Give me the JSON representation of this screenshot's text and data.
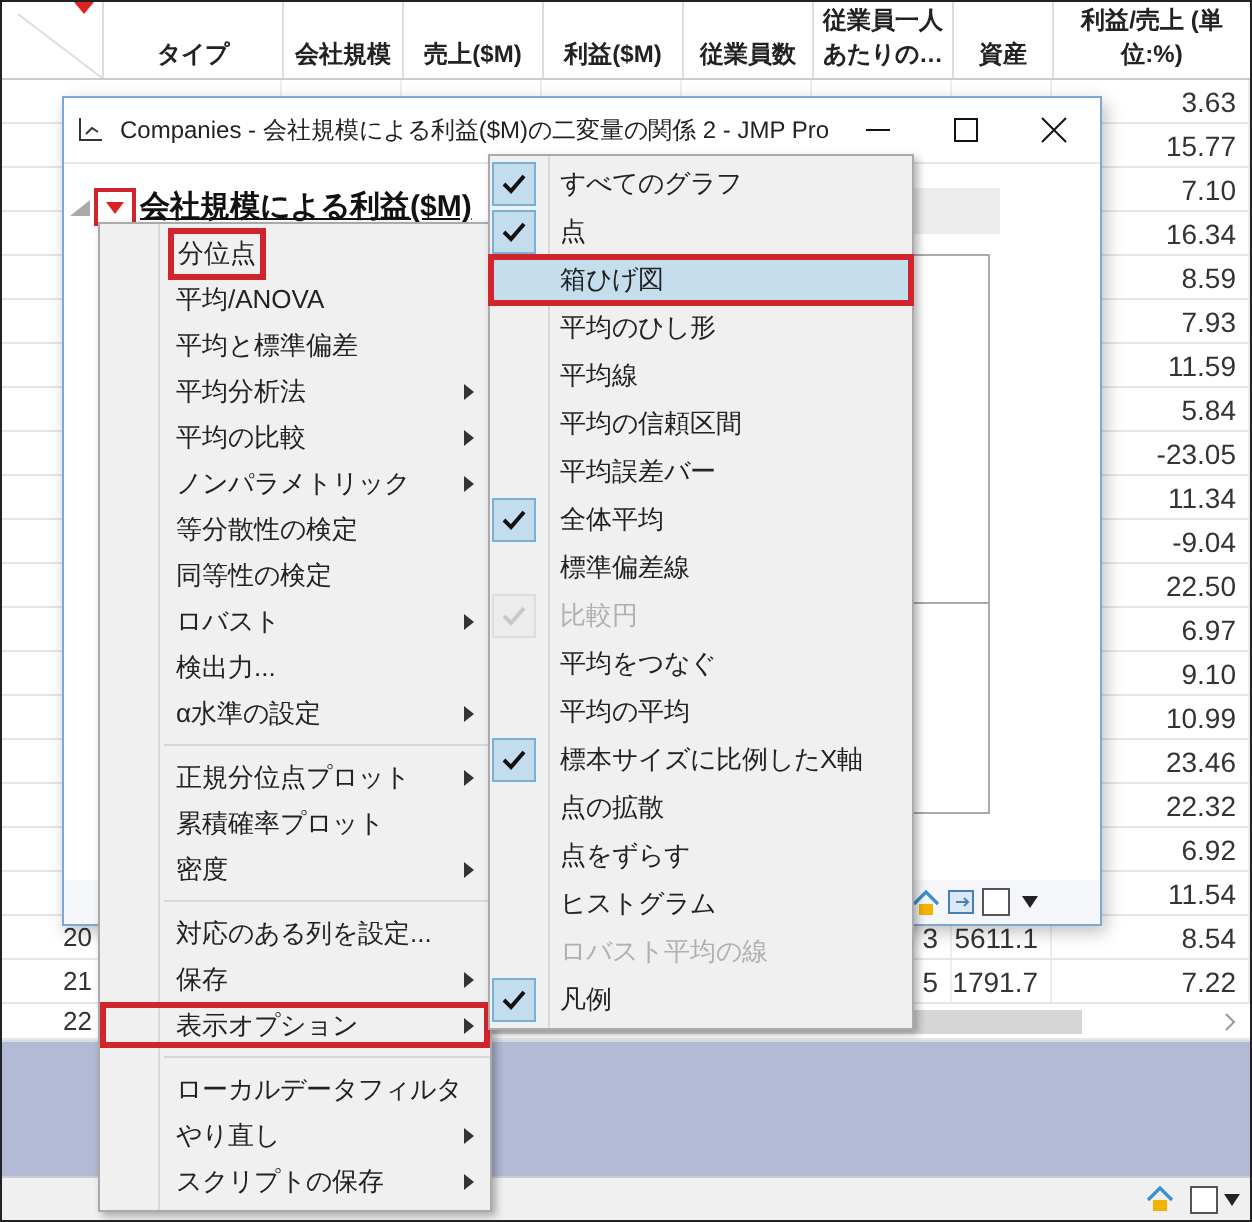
{
  "table": {
    "columns": [
      "タイプ",
      "会社規模",
      "売上($M)",
      "利益($M)",
      "従業員数",
      "従業員一人あたりの…",
      "資産",
      "利益/売上 (単位:%)"
    ],
    "rows": [
      {
        "cells": [
          null,
          null,
          null,
          null,
          null,
          null,
          null,
          "3.63"
        ]
      },
      {
        "cells": [
          null,
          null,
          null,
          null,
          null,
          null,
          null,
          "15.77"
        ]
      },
      {
        "cells": [
          null,
          null,
          null,
          null,
          null,
          null,
          null,
          "7.10"
        ]
      },
      {
        "cells": [
          null,
          null,
          null,
          null,
          null,
          null,
          null,
          "16.34"
        ]
      },
      {
        "cells": [
          null,
          null,
          null,
          null,
          null,
          null,
          null,
          "8.59"
        ]
      },
      {
        "cells": [
          null,
          null,
          null,
          null,
          null,
          null,
          null,
          "7.93"
        ]
      },
      {
        "cells": [
          null,
          null,
          null,
          null,
          null,
          null,
          null,
          "11.59"
        ]
      },
      {
        "cells": [
          null,
          null,
          null,
          null,
          null,
          null,
          null,
          "5.84"
        ]
      },
      {
        "cells": [
          null,
          null,
          null,
          null,
          null,
          null,
          null,
          "-23.05"
        ]
      },
      {
        "cells": [
          null,
          null,
          null,
          null,
          null,
          null,
          null,
          "11.34"
        ]
      },
      {
        "cells": [
          null,
          null,
          null,
          null,
          null,
          null,
          null,
          "-9.04"
        ]
      },
      {
        "cells": [
          null,
          null,
          null,
          null,
          null,
          null,
          null,
          "22.50"
        ]
      },
      {
        "cells": [
          null,
          null,
          null,
          null,
          null,
          null,
          null,
          "6.97"
        ]
      },
      {
        "cells": [
          null,
          null,
          null,
          null,
          null,
          null,
          null,
          "9.10"
        ]
      },
      {
        "cells": [
          null,
          null,
          null,
          null,
          null,
          null,
          null,
          "10.99"
        ]
      },
      {
        "cells": [
          null,
          null,
          null,
          null,
          null,
          null,
          null,
          "23.46"
        ]
      },
      {
        "cells": [
          null,
          null,
          null,
          null,
          null,
          null,
          null,
          "22.32"
        ]
      },
      {
        "cells": [
          null,
          null,
          null,
          null,
          null,
          null,
          null,
          "6.92"
        ]
      },
      {
        "cells": [
          null,
          null,
          null,
          null,
          null,
          null,
          null,
          "11.54"
        ]
      },
      {
        "number": "20",
        "cells": [
          null,
          null,
          null,
          null,
          null,
          "3",
          "5611.1",
          "8.54"
        ]
      },
      {
        "number": "21",
        "cells": [
          null,
          null,
          null,
          null,
          null,
          "5",
          "1791.7",
          "7.22"
        ]
      }
    ],
    "partial_row_number": "22"
  },
  "window": {
    "title": "Companies - 会社規模による利益($M)の二変量の関係 2 - JMP Pro",
    "heading": "会社規模による利益($M)"
  },
  "menu": {
    "groups": [
      [
        {
          "label": "分位点",
          "submenu": false,
          "annotated": true
        },
        {
          "label": "平均/ANOVA",
          "submenu": false,
          "annotated": false
        },
        {
          "label": "平均と標準偏差",
          "submenu": false,
          "annotated": false
        },
        {
          "label": "平均分析法",
          "submenu": true,
          "annotated": false
        },
        {
          "label": "平均の比較",
          "submenu": true,
          "annotated": false
        },
        {
          "label": "ノンパラメトリック",
          "submenu": true,
          "annotated": false
        },
        {
          "label": "等分散性の検定",
          "submenu": false,
          "annotated": false
        },
        {
          "label": "同等性の検定",
          "submenu": false,
          "annotated": false
        },
        {
          "label": "ロバスト",
          "submenu": true,
          "annotated": false
        },
        {
          "label": "検出力...",
          "submenu": false,
          "annotated": false
        },
        {
          "label": "α水準の設定",
          "submenu": true,
          "annotated": false
        }
      ],
      [
        {
          "label": "正規分位点プロット",
          "submenu": true,
          "annotated": false
        },
        {
          "label": "累積確率プロット",
          "submenu": false,
          "annotated": false
        },
        {
          "label": "密度",
          "submenu": true,
          "annotated": false
        }
      ],
      [
        {
          "label": "対応のある列を設定...",
          "submenu": false,
          "annotated": false
        },
        {
          "label": "保存",
          "submenu": true,
          "annotated": false
        },
        {
          "label": "表示オプション",
          "submenu": true,
          "annotated": true
        }
      ],
      [
        {
          "label": "ローカルデータフィルタ",
          "submenu": false,
          "annotated": false
        },
        {
          "label": "やり直し",
          "submenu": true,
          "annotated": false
        },
        {
          "label": "スクリプトの保存",
          "submenu": true,
          "annotated": false
        }
      ]
    ]
  },
  "submenu": {
    "items": [
      {
        "label": "すべてのグラフ",
        "checked": true,
        "disabled": false,
        "highlighted": false,
        "annotated": false
      },
      {
        "label": "点",
        "checked": true,
        "disabled": false,
        "highlighted": false,
        "annotated": false
      },
      {
        "label": "箱ひげ図",
        "checked": false,
        "disabled": false,
        "highlighted": true,
        "annotated": true
      },
      {
        "label": "平均のひし形",
        "checked": false,
        "disabled": false,
        "highlighted": false,
        "annotated": false
      },
      {
        "label": "平均線",
        "checked": false,
        "disabled": false,
        "highlighted": false,
        "annotated": false
      },
      {
        "label": "平均の信頼区間",
        "checked": false,
        "disabled": false,
        "highlighted": false,
        "annotated": false
      },
      {
        "label": "平均誤差バー",
        "checked": false,
        "disabled": false,
        "highlighted": false,
        "annotated": false
      },
      {
        "label": "全体平均",
        "checked": true,
        "disabled": false,
        "highlighted": false,
        "annotated": false
      },
      {
        "label": "標準偏差線",
        "checked": false,
        "disabled": false,
        "highlighted": false,
        "annotated": false
      },
      {
        "label": "比較円",
        "checked": true,
        "disabled": true,
        "highlighted": false,
        "annotated": false
      },
      {
        "label": "平均をつなぐ",
        "checked": false,
        "disabled": false,
        "highlighted": false,
        "annotated": false
      },
      {
        "label": "平均の平均",
        "checked": false,
        "disabled": false,
        "highlighted": false,
        "annotated": false
      },
      {
        "label": "標本サイズに比例したX軸",
        "checked": true,
        "disabled": false,
        "highlighted": false,
        "annotated": false
      },
      {
        "label": "点の拡散",
        "checked": false,
        "disabled": false,
        "highlighted": false,
        "annotated": false
      },
      {
        "label": "点をずらす",
        "checked": false,
        "disabled": false,
        "highlighted": false,
        "annotated": false
      },
      {
        "label": "ヒストグラム",
        "checked": false,
        "disabled": false,
        "highlighted": false,
        "annotated": false
      },
      {
        "label": "ロバスト平均の線",
        "checked": false,
        "disabled": true,
        "highlighted": false,
        "annotated": false
      },
      {
        "label": "凡例",
        "checked": true,
        "disabled": false,
        "highlighted": false,
        "annotated": false
      }
    ]
  }
}
